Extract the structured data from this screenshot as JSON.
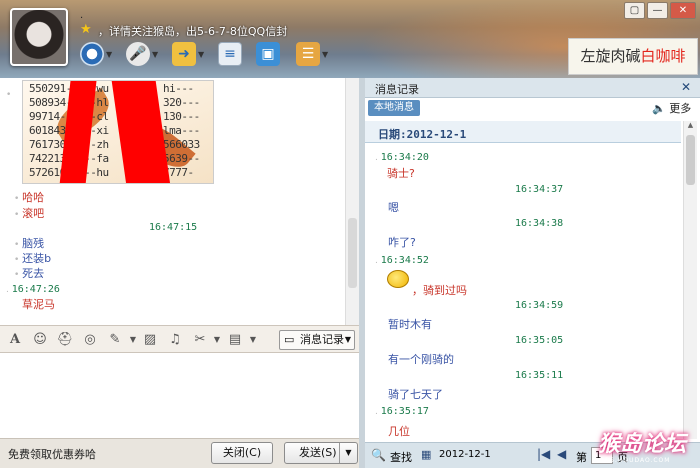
{
  "header": {
    "contact_name": ".",
    "signature": "，详情关注猴岛，出5-6-7-8位QQ信封",
    "toolbar_icons": [
      "video-call-icon",
      "voice-call-icon",
      "send-file-icon",
      "send-message-icon",
      "remote-assist-icon",
      "app-menu-icon"
    ],
    "window_buttons": [
      "▢",
      "—",
      "✕"
    ],
    "ad_text_plain": "左旋肉碱",
    "ad_text_red": "白咖啡"
  },
  "chat": {
    "image_lines": [
      "550291-----wu",
      "508934-----hl",
      "99714------cl",
      "601843-----xi",
      "761730-----zh",
      "742213-----fa",
      "572610-----hu"
    ],
    "image_lines_right": [
      "hi---",
      "320---",
      "130---",
      "lma---",
      "566033",
      "5639--",
      "7777-"
    ],
    "messages_top": [
      {
        "text": "哈哈",
        "color": "red"
      },
      {
        "text": "滚吧",
        "color": "red"
      }
    ],
    "time_1": "16:47:15",
    "messages_mid": [
      {
        "text": "脑残",
        "color": "blue"
      },
      {
        "text": "还装b",
        "color": "blue"
      },
      {
        "text": "死去",
        "color": "blue"
      }
    ],
    "time_2": "16:47:26",
    "last_message": "草泥马"
  },
  "input_toolbar": {
    "icons": [
      "font-icon",
      "smiley-icon",
      "hat-icon",
      "shake-icon",
      "edit-icon",
      "image-icon",
      "music-icon",
      "scissors-icon",
      "app-box-icon"
    ],
    "history_button": "消息记录"
  },
  "bottom": {
    "coupon": "免费领取优惠券哈",
    "close_button": "关闭(C)",
    "send_button": "发送(S)"
  },
  "history": {
    "title": "消息记录",
    "tab_local": "本地消息",
    "more": "更多",
    "date": "日期:2012-12-1",
    "entries": [
      {
        "time": "16:34:20",
        "side": "left",
        "text": "骑士?",
        "color": "red"
      },
      {
        "time": "16:34:37",
        "side": "right",
        "text": "嗯",
        "color": "blue"
      },
      {
        "time": "16:34:38",
        "side": "right",
        "text": "咋了?",
        "color": "blue"
      },
      {
        "time": "16:34:52",
        "side": "left",
        "text": "，骑到过吗",
        "color": "red"
      },
      {
        "time": "16:34:59",
        "side": "right",
        "text": "暂时木有",
        "color": "blue"
      },
      {
        "time": "16:35:05",
        "side": "right",
        "text": "有一个刚骑的",
        "color": "blue"
      },
      {
        "time": "16:35:11",
        "side": "right",
        "text": "骑了七天了",
        "color": "blue"
      },
      {
        "time": "16:35:17",
        "side": "left",
        "text": "几位",
        "color": "red"
      }
    ],
    "search": "查找",
    "footer_date": "2012-12-1",
    "page_label": "第",
    "page_value": "1",
    "page_suffix": "页"
  },
  "watermark": {
    "text": "猴岛论坛",
    "url": "BBS.HOUDAO.COM"
  },
  "colors": {
    "red": "#c8352a",
    "blue": "#3a55a6",
    "time": "#1a7a4a"
  }
}
